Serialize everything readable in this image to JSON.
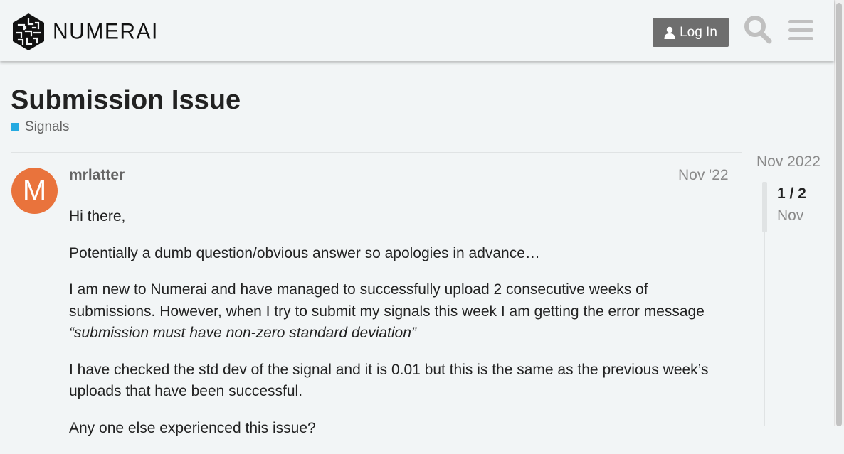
{
  "header": {
    "logo_text": "NUMERAI",
    "login_label": "Log In",
    "search_icon": "search-icon",
    "menu_icon": "hamburger-menu-icon"
  },
  "topic": {
    "title": "Submission Issue",
    "category": {
      "label": "Signals",
      "color": "#25aae1"
    }
  },
  "post": {
    "avatar_letter": "M",
    "avatar_color": "#e9733c",
    "username": "mrlatter",
    "date": "Nov '22",
    "paragraphs": {
      "p1": "Hi there,",
      "p2": "Potentially a dumb question/obvious answer so apologies in advance…",
      "p3": "I am new to Numerai and have managed to successfully upload 2 consecutive weeks of submissions. However, when I try to submit my signals this week I am getting the error message",
      "p3_quote": "“submission must have non-zero standard deviation”",
      "p4": "I have checked the std dev of the signal and it is 0.01 but this is the same as the previous week’s uploads that have been successful.",
      "p5": "Any one else experienced this issue?"
    }
  },
  "timeline": {
    "start_date": "Nov 2022",
    "position": "1 / 2",
    "current_date": "Nov"
  }
}
